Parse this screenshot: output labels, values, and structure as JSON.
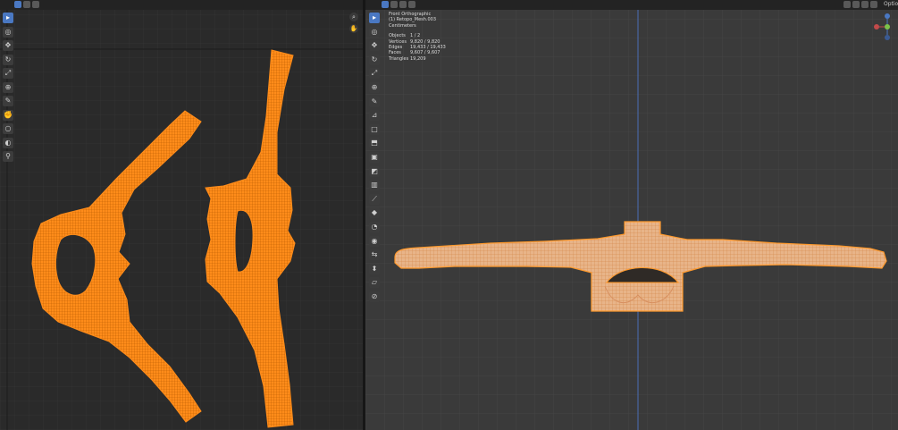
{
  "colors": {
    "mesh": "#ff8c1a",
    "mesh_wire": "#d96e00",
    "mesh_solid": "#e6b07a",
    "active": "#4a78c2",
    "grid_major": "#454545",
    "grid_minor": "#333333"
  },
  "uv_editor": {
    "tools": [
      "select-tool",
      "cursor-tool",
      "move-tool",
      "rotate-tool",
      "scale-tool",
      "transform-tool",
      "annotate-tool",
      "grab-tool",
      "relax-tool",
      "pinch-tool",
      "pin-tool"
    ],
    "nav_icons": [
      "zoom-icon",
      "hand-icon"
    ]
  },
  "viewport": {
    "overlay": {
      "view_name": "Front Orthographic",
      "object_name": "(1) Retopo_Mesh.003",
      "units": "Centimeters"
    },
    "stats": [
      {
        "label": "Objects",
        "value": "1 / 2"
      },
      {
        "label": "Vertices",
        "value": "9,820 / 9,820"
      },
      {
        "label": "Edges",
        "value": "19,433 / 19,433"
      },
      {
        "label": "Faces",
        "value": "9,607 / 9,607"
      },
      {
        "label": "Triangles",
        "value": "19,209"
      }
    ],
    "header_right_label": "Optio",
    "tools": [
      "select-tool",
      "cursor-tool",
      "move-tool",
      "rotate-tool",
      "scale-tool",
      "transform-tool",
      "annotate-tool",
      "measure-tool",
      "add-cube-tool",
      "extrude-tool",
      "inset-tool",
      "bevel-tool",
      "loop-cut-tool",
      "knife-tool",
      "poly-build-tool",
      "spin-tool",
      "smooth-tool",
      "edge-slide-tool",
      "shrink-fatten-tool",
      "shear-tool",
      "rip-tool"
    ]
  }
}
